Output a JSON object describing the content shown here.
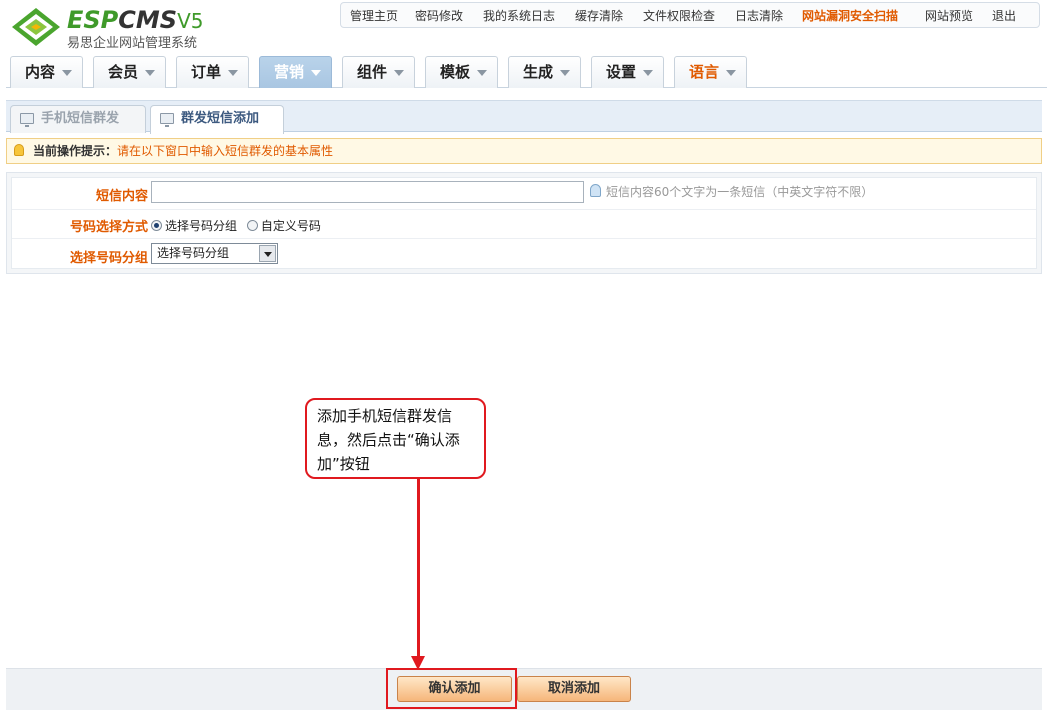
{
  "brand": {
    "logo_text_green": "ESP",
    "logo_text_dark": "CMS",
    "logo_version": "V5",
    "subtitle": "易思企业网站管理系统"
  },
  "topbar": {
    "items": [
      {
        "label": "管理主页"
      },
      {
        "label": "密码修改"
      },
      {
        "label": "我的系统日志"
      },
      {
        "label": "缓存清除"
      },
      {
        "label": "文件权限检查"
      },
      {
        "label": "日志清除"
      },
      {
        "label": "网站漏洞安全扫描",
        "highlight": true
      },
      {
        "label": "网站预览"
      },
      {
        "label": "退出"
      }
    ]
  },
  "nav": {
    "tabs": [
      {
        "label": "内容"
      },
      {
        "label": "会员"
      },
      {
        "label": "订单"
      },
      {
        "label": "营销",
        "active": true
      },
      {
        "label": "组件"
      },
      {
        "label": "模板"
      },
      {
        "label": "生成"
      },
      {
        "label": "设置"
      },
      {
        "label": "语言",
        "accent": true
      }
    ]
  },
  "subtabs": [
    {
      "label": "手机短信群发",
      "active": false
    },
    {
      "label": "群发短信添加",
      "active": true
    }
  ],
  "tip": {
    "label": "当前操作提示：",
    "text": "请在以下窗口中输入短信群发的基本属性"
  },
  "form": {
    "sms_content_label": "短信内容",
    "sms_content_value": "",
    "sms_content_hint": "短信内容60个文字为一条短信（中英文字符不限）",
    "number_mode_label": "号码选择方式",
    "number_mode_options": [
      "选择号码分组",
      "自定义号码"
    ],
    "number_mode_selected": "选择号码分组",
    "group_label": "选择号码分组",
    "group_selected": "选择号码分组"
  },
  "callout": {
    "text": "添加手机短信群发信息，然后点击“确认添加”按钮"
  },
  "buttons": {
    "confirm": "确认添加",
    "cancel": "取消添加"
  },
  "colors": {
    "accent_orange": "#e05a00",
    "brand_green": "#3f9a2a",
    "annotation_red": "#e0191f",
    "nav_active": "#a9c6e2"
  }
}
